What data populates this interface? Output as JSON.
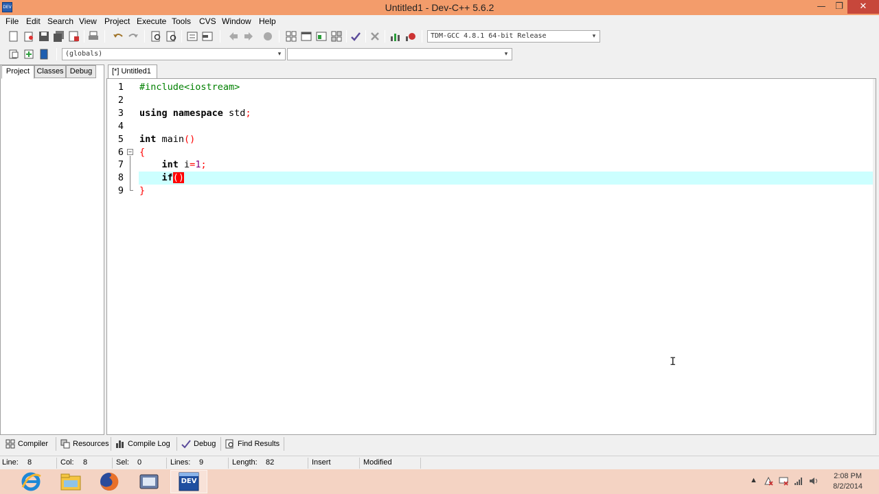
{
  "window": {
    "title": "Untitled1 - Dev-C++ 5.6.2",
    "minimize": "—",
    "maximize": "❐",
    "close": "✕"
  },
  "menu": [
    "File",
    "Edit",
    "Search",
    "View",
    "Project",
    "Execute",
    "Tools",
    "CVS",
    "Window",
    "Help"
  ],
  "toolbar": {
    "compiler_select": "TDM-GCC 4.8.1 64-bit Release",
    "scope_select": "(globals)",
    "symbol_select": ""
  },
  "left_panel": {
    "tabs": [
      "Project",
      "Classes",
      "Debug"
    ],
    "active_tab": "Project"
  },
  "editor": {
    "tab_label": "[*] Untitled1",
    "current_line": 8,
    "line_numbers": [
      "1",
      "2",
      "3",
      "4",
      "5",
      "6",
      "7",
      "8",
      "9"
    ]
  },
  "bottom_tabs": [
    "Compiler",
    "Resources",
    "Compile Log",
    "Debug",
    "Find Results"
  ],
  "status": {
    "line_label": "Line:",
    "line_value": "8",
    "col_label": "Col:",
    "col_value": "8",
    "sel_label": "Sel:",
    "sel_value": "0",
    "lines_label": "Lines:",
    "lines_value": "9",
    "length_label": "Length:",
    "length_value": "82",
    "mode": "Insert",
    "modified": "Modified"
  },
  "taskbar": {
    "apps": [
      "internet-explorer",
      "file-explorer",
      "firefox",
      "video-app",
      "dev-cpp"
    ],
    "dev_label": "DEV",
    "clock_time": "2:08 PM",
    "clock_date": "8/2/2014"
  },
  "colors": {
    "titlebar": "#f39c6b",
    "current_line": "#ccffff",
    "preprocessor": "#008000",
    "symbol": "#ff0000",
    "number": "#800080"
  }
}
